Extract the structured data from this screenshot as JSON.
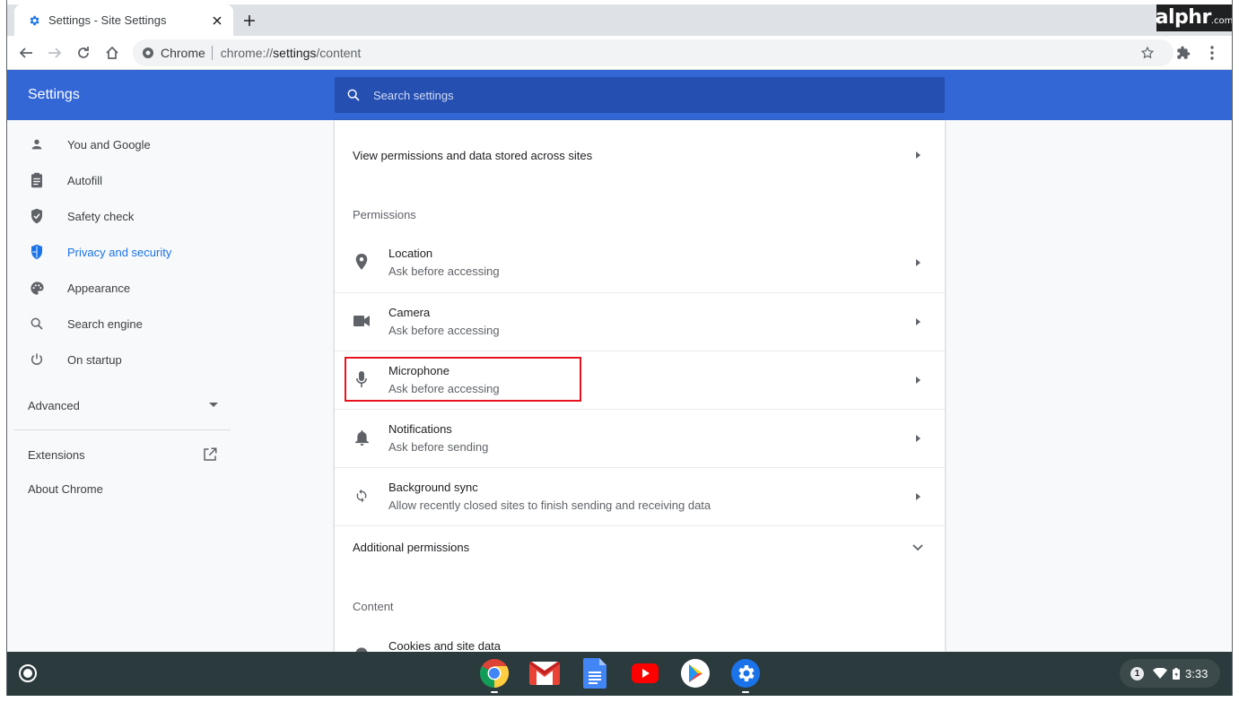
{
  "browser": {
    "tab_title": "Settings - Site Settings",
    "new_tab_icon": "plus-icon",
    "omnibox_chip": "Chrome",
    "url_scheme": "chrome://",
    "url_host": "settings",
    "url_path": "/content"
  },
  "watermark": {
    "main": "alphr",
    "suffix": ".com"
  },
  "settings": {
    "title": "Settings",
    "search_placeholder": "Search settings"
  },
  "sidebar": {
    "items": [
      {
        "label": "You and Google",
        "icon": "person-icon"
      },
      {
        "label": "Autofill",
        "icon": "clipboard-icon"
      },
      {
        "label": "Safety check",
        "icon": "shield-check-icon"
      },
      {
        "label": "Privacy and security",
        "icon": "shield-icon",
        "active": true
      },
      {
        "label": "Appearance",
        "icon": "palette-icon"
      },
      {
        "label": "Search engine",
        "icon": "search-icon"
      },
      {
        "label": "On startup",
        "icon": "power-icon"
      }
    ],
    "advanced": "Advanced",
    "extensions": "Extensions",
    "about": "About Chrome"
  },
  "content": {
    "view_permissions": "View permissions and data stored across sites",
    "permissions_header": "Permissions",
    "permissions": [
      {
        "title": "Location",
        "subtitle": "Ask before accessing",
        "icon": "location-pin-icon"
      },
      {
        "title": "Camera",
        "subtitle": "Ask before accessing",
        "icon": "camera-icon"
      },
      {
        "title": "Microphone",
        "subtitle": "Ask before accessing",
        "icon": "microphone-icon"
      },
      {
        "title": "Notifications",
        "subtitle": "Ask before sending",
        "icon": "bell-icon"
      },
      {
        "title": "Background sync",
        "subtitle": "Allow recently closed sites to finish sending and receiving data",
        "icon": "sync-icon"
      }
    ],
    "additional_permissions": "Additional permissions",
    "content_header": "Content",
    "cookies": "Cookies and site data"
  },
  "shelf": {
    "apps": [
      "chrome-app-icon",
      "gmail-app-icon",
      "docs-app-icon",
      "youtube-app-icon",
      "play-store-app-icon",
      "settings-app-icon"
    ],
    "notification_count": "1",
    "time": "3:33"
  },
  "colors": {
    "header_blue": "#3367d6",
    "accent_blue": "#1a73e8",
    "highlight_red": "#e8131f"
  }
}
